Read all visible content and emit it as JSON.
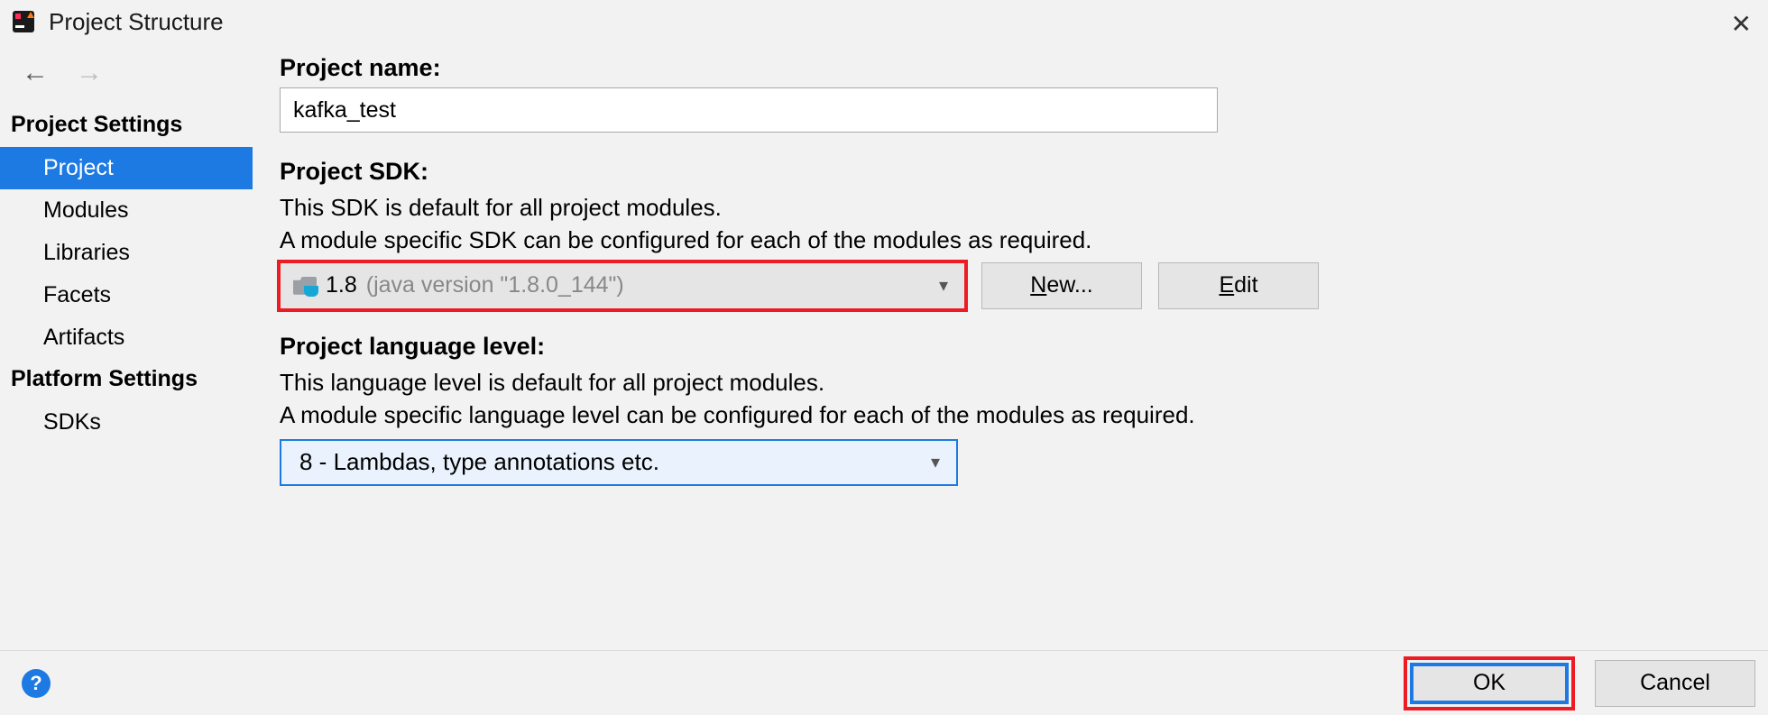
{
  "window": {
    "title": "Project Structure"
  },
  "sidebar": {
    "sections": [
      {
        "header": "Project Settings",
        "items": [
          {
            "label": "Project",
            "selected": true
          },
          {
            "label": "Modules",
            "selected": false
          },
          {
            "label": "Libraries",
            "selected": false
          },
          {
            "label": "Facets",
            "selected": false
          },
          {
            "label": "Artifacts",
            "selected": false
          }
        ]
      },
      {
        "header": "Platform Settings",
        "items": [
          {
            "label": "SDKs",
            "selected": false
          }
        ]
      }
    ]
  },
  "main": {
    "projectNameLabel": "Project name:",
    "projectNameValue": "kafka_test",
    "projectSdkLabel": "Project SDK:",
    "sdkDesc1": "This SDK is default for all project modules.",
    "sdkDesc2": "A module specific SDK can be configured for each of the modules as required.",
    "sdkVersion": "1.8",
    "sdkDetail": "(java version \"1.8.0_144\")",
    "newBtn": "New...",
    "editBtn": "Edit",
    "langLevelLabel": "Project language level:",
    "langDesc1": "This language level is default for all project modules.",
    "langDesc2": "A module specific language level can be configured for each of the modules as required.",
    "langLevelValue": "8 - Lambdas, type annotations etc."
  },
  "footer": {
    "ok": "OK",
    "cancel": "Cancel"
  }
}
